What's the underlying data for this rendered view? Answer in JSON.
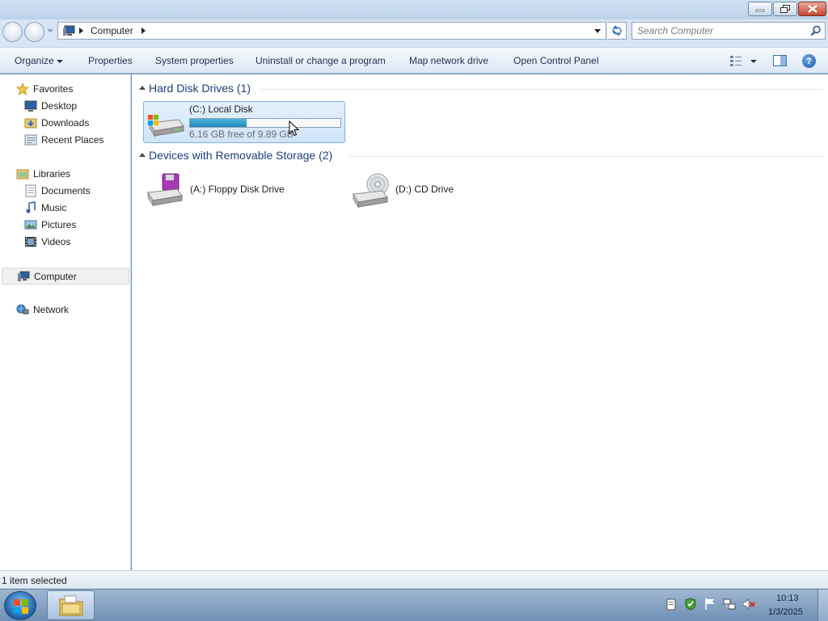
{
  "window": {
    "minimize_icon": "minimize-icon",
    "maximize_icon": "restore-icon",
    "close_icon": "close-icon"
  },
  "address_bar": {
    "location": "Computer",
    "search_placeholder": "Search Computer"
  },
  "command_bar": {
    "organize": "Organize",
    "properties": "Properties",
    "system_properties": "System properties",
    "uninstall": "Uninstall or change a program",
    "map_network_drive": "Map network drive",
    "open_control_panel": "Open Control Panel"
  },
  "nav_pane": {
    "favorites": "Favorites",
    "favorites_items": [
      "Desktop",
      "Downloads",
      "Recent Places"
    ],
    "libraries": "Libraries",
    "libraries_items": [
      "Documents",
      "Music",
      "Pictures",
      "Videos"
    ],
    "computer": "Computer",
    "network": "Network"
  },
  "content": {
    "hard_disk_group": "Hard Disk Drives (1)",
    "removable_group": "Devices with Removable Storage (2)",
    "drive_c": {
      "name": "(C:) Local Disk",
      "free_text": "6.16 GB free of 9.89 GB",
      "free_gb": 6.16,
      "total_gb": 9.89,
      "used_fraction": 0.377
    },
    "floppy": "(A:) Floppy Disk Drive",
    "cd": "(D:) CD Drive"
  },
  "status": {
    "selection": "1 item selected"
  },
  "taskbar": {
    "time": "10:13",
    "date": "1/3/2025"
  },
  "colors": {
    "accent": "#1f8ab8",
    "selection": "#cfe4fa",
    "group_header": "#1e3d7a"
  }
}
